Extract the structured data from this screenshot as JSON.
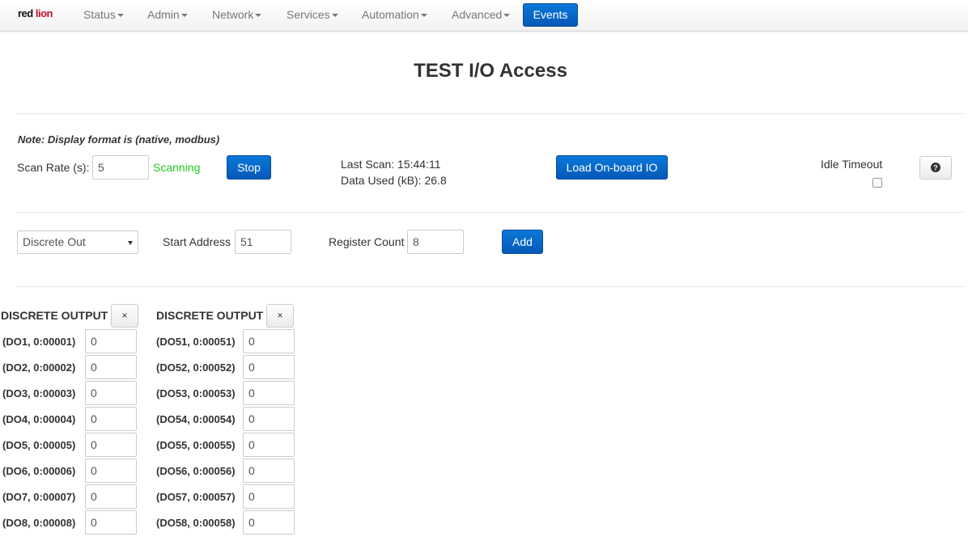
{
  "navbar": {
    "logo": {
      "part1": "red",
      "part2": "lion"
    },
    "items": [
      {
        "label": "Status"
      },
      {
        "label": "Admin"
      },
      {
        "label": "Network"
      },
      {
        "label": "Services"
      },
      {
        "label": "Automation"
      },
      {
        "label": "Advanced"
      }
    ],
    "events_label": "Events"
  },
  "page_title": "TEST I/O Access",
  "note": "Note: Display format is (native, modbus)",
  "scan": {
    "rate_label": "Scan Rate (s):",
    "rate_value": "5",
    "status": "Scanning",
    "stop_label": "Stop",
    "last_scan": "Last Scan: 15:44:11",
    "data_used": "Data Used (kB): 26.8",
    "load_label": "Load On-board IO",
    "idle_timeout_label": "Idle Timeout",
    "help_icon": "question-circle-icon"
  },
  "add_form": {
    "type_selected": "Discrete Out",
    "start_address_label": "Start Address",
    "start_address_value": "51",
    "register_count_label": "Register Count",
    "register_count_value": "8",
    "add_label": "Add"
  },
  "columns": [
    {
      "title": "DISCRETE OUTPUT",
      "close_label": "×",
      "rows": [
        {
          "label": "(DO1, 0:00001)",
          "value": "0"
        },
        {
          "label": "(DO2, 0:00002)",
          "value": "0"
        },
        {
          "label": "(DO3, 0:00003)",
          "value": "0"
        },
        {
          "label": "(DO4, 0:00004)",
          "value": "0"
        },
        {
          "label": "(DO5, 0:00005)",
          "value": "0"
        },
        {
          "label": "(DO6, 0:00006)",
          "value": "0"
        },
        {
          "label": "(DO7, 0:00007)",
          "value": "0"
        },
        {
          "label": "(DO8, 0:00008)",
          "value": "0"
        }
      ]
    },
    {
      "title": "DISCRETE OUTPUT",
      "close_label": "×",
      "rows": [
        {
          "label": "(DO51, 0:00051)",
          "value": "0"
        },
        {
          "label": "(DO52, 0:00052)",
          "value": "0"
        },
        {
          "label": "(DO53, 0:00053)",
          "value": "0"
        },
        {
          "label": "(DO54, 0:00054)",
          "value": "0"
        },
        {
          "label": "(DO55, 0:00055)",
          "value": "0"
        },
        {
          "label": "(DO56, 0:00056)",
          "value": "0"
        },
        {
          "label": "(DO57, 0:00057)",
          "value": "0"
        },
        {
          "label": "(DO58, 0:00058)",
          "value": "0"
        }
      ]
    }
  ],
  "colors": {
    "accent": "#0559b8",
    "scanning": "#22cc22",
    "logo_red": "#c8102e"
  }
}
